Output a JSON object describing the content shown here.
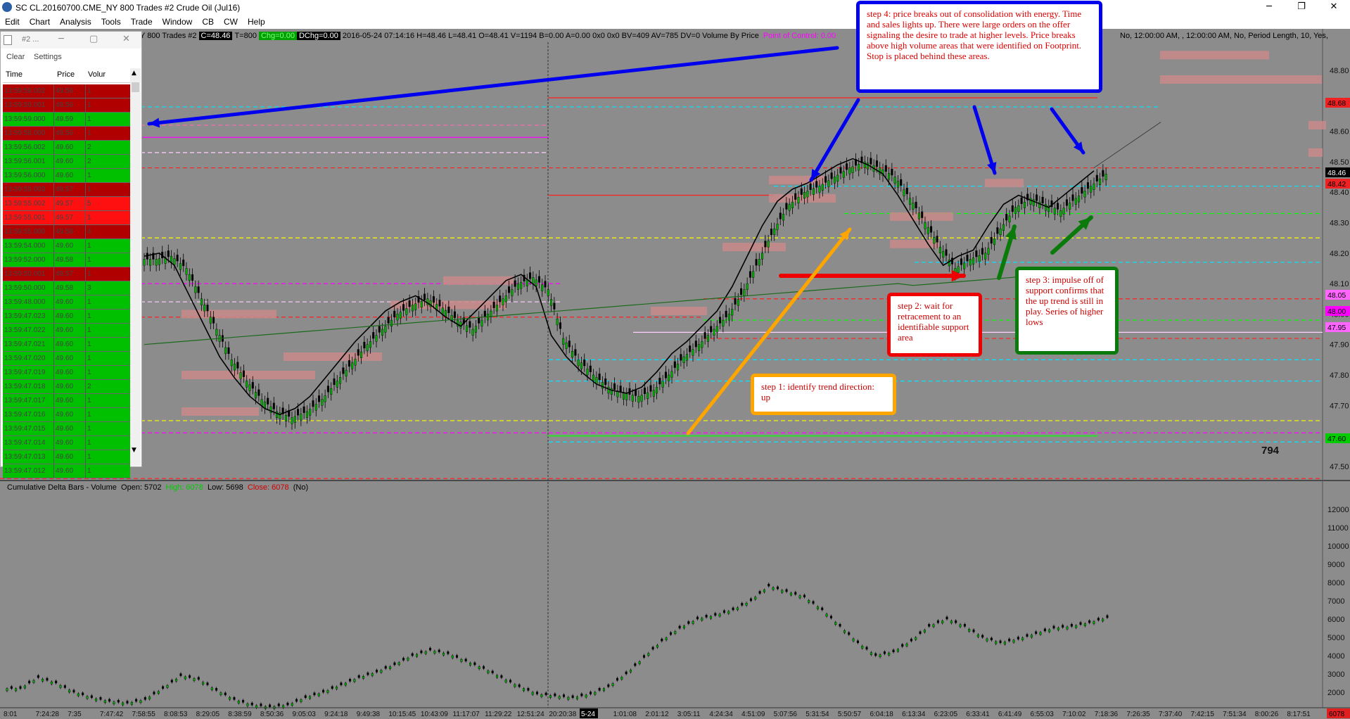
{
  "window": {
    "title": "SC CL.20160700.CME_NY  800 Trades  #2  Crude Oil (Jul16)",
    "minimize_glyph": "─",
    "restore_glyph": "❐",
    "close_glyph": "✕"
  },
  "menu": [
    "Edit",
    "Chart",
    "Analysis",
    "Tools",
    "Trade",
    "Window",
    "CB",
    "CW",
    "Help"
  ],
  "status": {
    "prefix": "Y  800 Trades  #2",
    "close": "C=48.46",
    "trades": "T=800",
    "chg": "Chg=0.00",
    "dchg": "DChg=0.00",
    "ohlc": "2016-05-24  07:14:16  H=48.46  L=48.41  O=48.41  V=1194  B=0.00  A=0.00  0x0  0x0  BV=409  AV=785  DV=0  Volume By Price",
    "poc": "Point of Control: 0.00",
    "right": "No, 12:00:00 AM, , 12:00:00 AM, No, Period Length, 10, Yes,"
  },
  "time_and_sales": {
    "title": "#2 ...",
    "menu": [
      "Clear",
      "Settings"
    ],
    "columns": [
      "Time",
      "Price",
      "Volur"
    ],
    "rows": [
      {
        "time": "13:59:59.002",
        "price": "49.56",
        "vol": "1",
        "side": "sell"
      },
      {
        "time": "13:59:59.001",
        "price": "49.56",
        "vol": "1",
        "side": "sell"
      },
      {
        "time": "13:59:59.000",
        "price": "49.59",
        "vol": "1",
        "side": "buy"
      },
      {
        "time": "13:59:58.000",
        "price": "49.56",
        "vol": "1",
        "side": "sell"
      },
      {
        "time": "13:59:56.002",
        "price": "49.60",
        "vol": "2",
        "side": "buy"
      },
      {
        "time": "13:59:56.001",
        "price": "49.60",
        "vol": "2",
        "side": "buy"
      },
      {
        "time": "13:59:56.000",
        "price": "49.60",
        "vol": "1",
        "side": "buy"
      },
      {
        "time": "13:59:55.003",
        "price": "49.57",
        "vol": "1",
        "side": "sell"
      },
      {
        "time": "13:59:55.002",
        "price": "49.57",
        "vol": "5",
        "side": "sellb"
      },
      {
        "time": "13:59:55.001",
        "price": "49.57",
        "vol": "1",
        "side": "sellb"
      },
      {
        "time": "13:59:55.000",
        "price": "49.58",
        "vol": "4",
        "side": "sell"
      },
      {
        "time": "13:59:54.000",
        "price": "49.60",
        "vol": "1",
        "side": "buy"
      },
      {
        "time": "13:59:52.000",
        "price": "49.58",
        "vol": "1",
        "side": "buy"
      },
      {
        "time": "13:59:50.001",
        "price": "49.57",
        "vol": "1",
        "side": "sell"
      },
      {
        "time": "13:59:50.000",
        "price": "49.58",
        "vol": "3",
        "side": "buy"
      },
      {
        "time": "13:59:48.000",
        "price": "49.60",
        "vol": "1",
        "side": "buy"
      },
      {
        "time": "13:59:47.023",
        "price": "49.60",
        "vol": "1",
        "side": "buy"
      },
      {
        "time": "13:59:47.022",
        "price": "49.60",
        "vol": "1",
        "side": "buy"
      },
      {
        "time": "13:59:47.021",
        "price": "49.60",
        "vol": "1",
        "side": "buy"
      },
      {
        "time": "13:59:47.020",
        "price": "49.60",
        "vol": "1",
        "side": "buy"
      },
      {
        "time": "13:59:47.019",
        "price": "49.60",
        "vol": "1",
        "side": "buy"
      },
      {
        "time": "13:59:47.018",
        "price": "49.60",
        "vol": "2",
        "side": "buy"
      },
      {
        "time": "13:59:47.017",
        "price": "49.60",
        "vol": "1",
        "side": "buy"
      },
      {
        "time": "13:59:47.016",
        "price": "49.60",
        "vol": "1",
        "side": "buy"
      },
      {
        "time": "13:59:47.015",
        "price": "49.60",
        "vol": "1",
        "side": "buy"
      },
      {
        "time": "13:59:47.014",
        "price": "49.60",
        "vol": "1",
        "side": "buy"
      },
      {
        "time": "13:59:47.013",
        "price": "49.60",
        "vol": "1",
        "side": "buy"
      },
      {
        "time": "13:59:47.012",
        "price": "49.60",
        "vol": "1",
        "side": "buy"
      }
    ]
  },
  "notes": {
    "step1": "step 1: identify trend direction:  up",
    "step2": "step 2: wait for retracement to an identifiable support area",
    "step3": "step 3: impulse off of support confirms that the up trend is still in play. Series of higher lows",
    "step4": "step 4: price breaks out of consolidation  with energy. Time and sales lights up. There were large orders on the offer signaling the desire to trade at higher levels. Price breaks above high volume areas that were identified on Footprint.  Stop is placed behind these areas."
  },
  "price_axis": [
    "48.80",
    "48.70",
    "48.60",
    "48.50",
    "48.40",
    "48.30",
    "48.20",
    "48.10",
    "48.00",
    "47.90",
    "47.80",
    "47.70",
    "47.60",
    "47.50"
  ],
  "price_tags": [
    {
      "label": "48.68",
      "color": "#ee2222"
    },
    {
      "label": "48.46",
      "color": "#000000"
    },
    {
      "label": "48.42",
      "color": "#ee2222"
    },
    {
      "label": "48.05",
      "color": "#ff66ff"
    },
    {
      "label": "48.00",
      "color": "#ff00ff"
    },
    {
      "label": "47.95",
      "color": "#ff66ff"
    },
    {
      "label": "47.60",
      "color": "#00cc00"
    }
  ],
  "lower_pane": {
    "label": "Cumulative Delta Bars - Volume",
    "open": "Open: 5702",
    "high": "High: 6078",
    "low": "Low: 5698",
    "close": "Close: 6078",
    "no": "(No)",
    "axis": [
      "12000",
      "11000",
      "10000",
      "9000",
      "8000",
      "7000",
      "6000",
      "5000",
      "4000",
      "3000",
      "2000"
    ],
    "tag": "6078"
  },
  "bar_count": "794",
  "time_axis": [
    "8:01",
    "7:24:28",
    "7:35",
    "7:47:42",
    "7:58:55",
    "8:08:53",
    "8:29:05",
    "8:38:59",
    "8:50:36",
    "9:05:03",
    "9:24:18",
    "9:49:38",
    "10:15:45",
    "10:43:09",
    "11:17:07",
    "11:29:22",
    "12:51:24",
    "20:20:38",
    "5-24",
    "1:01:08",
    "2:01:12",
    "3:05:11",
    "4:24:34",
    "4:51:09",
    "5:07:56",
    "5:31:54",
    "5:50:57",
    "6:04:18",
    "6:13:34",
    "6:23:05",
    "6:33:41",
    "6:41:49",
    "6:55:03",
    "7:10:02",
    "7:18:36",
    "7:26:35",
    "7:37:40",
    "7:42:15",
    "7:51:34",
    "8:00:26",
    "8:17:51"
  ],
  "chart_data": {
    "type": "candlestick",
    "instrument": "Crude Oil (Jul16)",
    "price_close": [
      48.18,
      48.19,
      48.15,
      48.05,
      47.95,
      47.85,
      47.78,
      47.72,
      47.68,
      47.66,
      47.68,
      47.72,
      47.78,
      47.84,
      47.9,
      47.95,
      48.0,
      48.03,
      48.05,
      48.02,
      47.98,
      47.95,
      48.0,
      48.05,
      48.1,
      48.12,
      48.08,
      47.92,
      47.85,
      47.8,
      47.76,
      47.74,
      47.73,
      47.75,
      47.8,
      47.86,
      47.9,
      47.95,
      48.0,
      48.08,
      48.18,
      48.28,
      48.36,
      48.4,
      48.42,
      48.45,
      48.48,
      48.5,
      48.48,
      48.45,
      48.38,
      48.3,
      48.22,
      48.15,
      48.18,
      48.2,
      48.28,
      48.35,
      48.38,
      48.36,
      48.34,
      48.38,
      48.42,
      48.46
    ],
    "cumulative_delta": [
      2200,
      2800,
      2500,
      2000,
      1700,
      1500,
      1400,
      1600,
      2200,
      2900,
      2700,
      2100,
      1600,
      1300,
      1200,
      1300,
      1700,
      2000,
      2400,
      2800,
      3100,
      3500,
      4000,
      4300,
      4100,
      3700,
      3300,
      2800,
      2300,
      1900,
      1800,
      1700,
      1900,
      2300,
      3000,
      3900,
      4800,
      5500,
      6000,
      6200,
      6500,
      7000,
      7800,
      7500,
      7200,
      6500,
      5600,
      4700,
      4000,
      4200,
      4800,
      5600,
      6000,
      5600,
      5000,
      4700,
      4900,
      5200,
      5500,
      5600,
      5800,
      6078
    ]
  }
}
